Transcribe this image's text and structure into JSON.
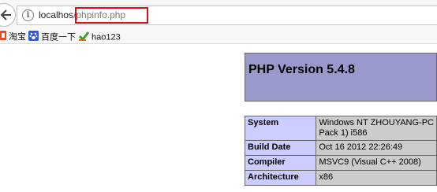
{
  "browser": {
    "url_host": "localhos",
    "url_slash": "/",
    "url_path": "phpinfo.php"
  },
  "bookmarks": [
    {
      "label": "淘宝",
      "icon": "taobao-icon"
    },
    {
      "label": "百度一下",
      "icon": "baidu-paw-icon"
    },
    {
      "label": "hao123",
      "icon": "hao123-icon"
    }
  ],
  "phpinfo": {
    "title": "PHP Version 5.4.8",
    "rows": [
      {
        "key": "System",
        "value_line1": "Windows NT ZHOUYANG-PC",
        "value_line2": "Pack 1) i586"
      },
      {
        "key": "Build Date",
        "value": "Oct 16 2012 22:26:49"
      },
      {
        "key": "Compiler",
        "value": "MSVC9 (Visual C++ 2008)"
      },
      {
        "key": "Architecture",
        "value": "x86"
      }
    ]
  },
  "colors": {
    "header_bg": "#9999cc",
    "key_cell_bg": "#ccccff",
    "value_cell_bg": "#cccccc",
    "highlight_border": "#e00b14"
  }
}
